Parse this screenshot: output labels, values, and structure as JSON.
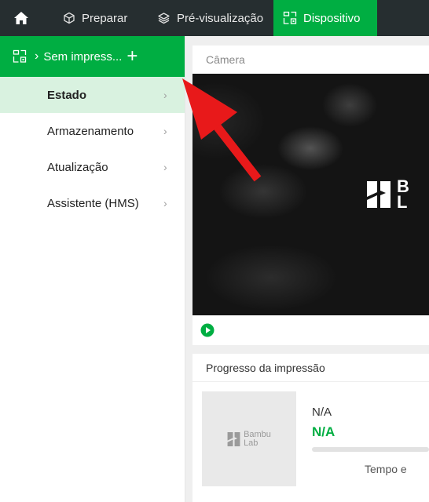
{
  "topbar": {
    "tabs": [
      {
        "label": "Preparar",
        "icon": "cube-icon",
        "active": false
      },
      {
        "label": "Pré-visualização",
        "icon": "layers-icon",
        "active": false
      },
      {
        "label": "Dispositivo",
        "icon": "device-icon",
        "active": true
      }
    ],
    "home_icon": "home-icon"
  },
  "sidebar": {
    "printer": {
      "label": "Sem impress...",
      "chevron": "›",
      "add": "+"
    },
    "items": [
      {
        "label": "Estado",
        "active": true
      },
      {
        "label": "Armazenamento",
        "active": false
      },
      {
        "label": "Atualização",
        "active": false
      },
      {
        "label": "Assistente (HMS)",
        "active": false
      }
    ],
    "chevron": "›"
  },
  "camera": {
    "title": "Câmera",
    "logo_text_line1": "B",
    "logo_text_line2": "L"
  },
  "progress": {
    "title": "Progresso da impressão",
    "thumb_logo_line1": "Bambu",
    "thumb_logo_line2": "Lab",
    "task_name": "N/A",
    "status": "N/A",
    "progress_fraction": 0,
    "time_label": "Tempo e"
  },
  "colors": {
    "accent": "#00AE42",
    "topbar": "#262E30",
    "annotation": "#E8191A"
  }
}
